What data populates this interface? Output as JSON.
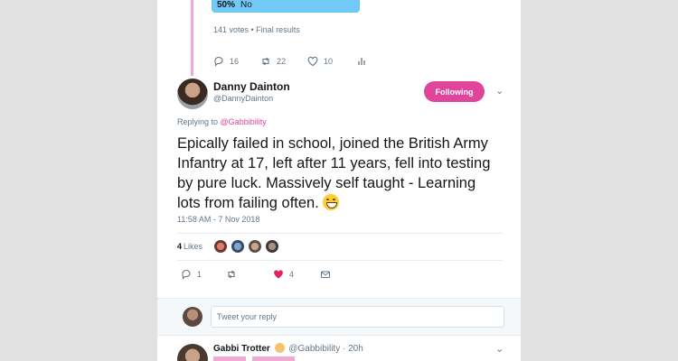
{
  "colors": {
    "accent": "#e0459b",
    "poll_bar": "#71c9f8",
    "thread_line": "#f3a6dd",
    "muted": "#657786"
  },
  "poll": {
    "option_percent": "50%",
    "option_label": "No",
    "meta": "141 votes • Final results"
  },
  "poll_actions": {
    "replies": "16",
    "retweets": "22",
    "likes": "10"
  },
  "tweet": {
    "author_name": "Danny Dainton",
    "author_handle": "@DannyDainton",
    "follow_label": "Following",
    "replying_prefix": "Replying to",
    "replying_to": "@Gabbibility",
    "text": "Epically failed in school, joined the British Army Infantry at 17, left after 11 years, fell into testing by pure luck. Massively self taught - Learning lots from failing often.",
    "emoji_icon": "grinning-face-icon",
    "timestamp": "11:58 AM - 7 Nov 2018",
    "likes_count": "4",
    "likes_label": "Likes",
    "actions": {
      "replies": "1",
      "retweets": "",
      "likes": "4"
    }
  },
  "reply_box": {
    "placeholder": "Tweet your reply"
  },
  "next_tweet": {
    "author_name": "Gabbi Trotter",
    "author_handle": "@Gabbibility",
    "time": "20h"
  }
}
